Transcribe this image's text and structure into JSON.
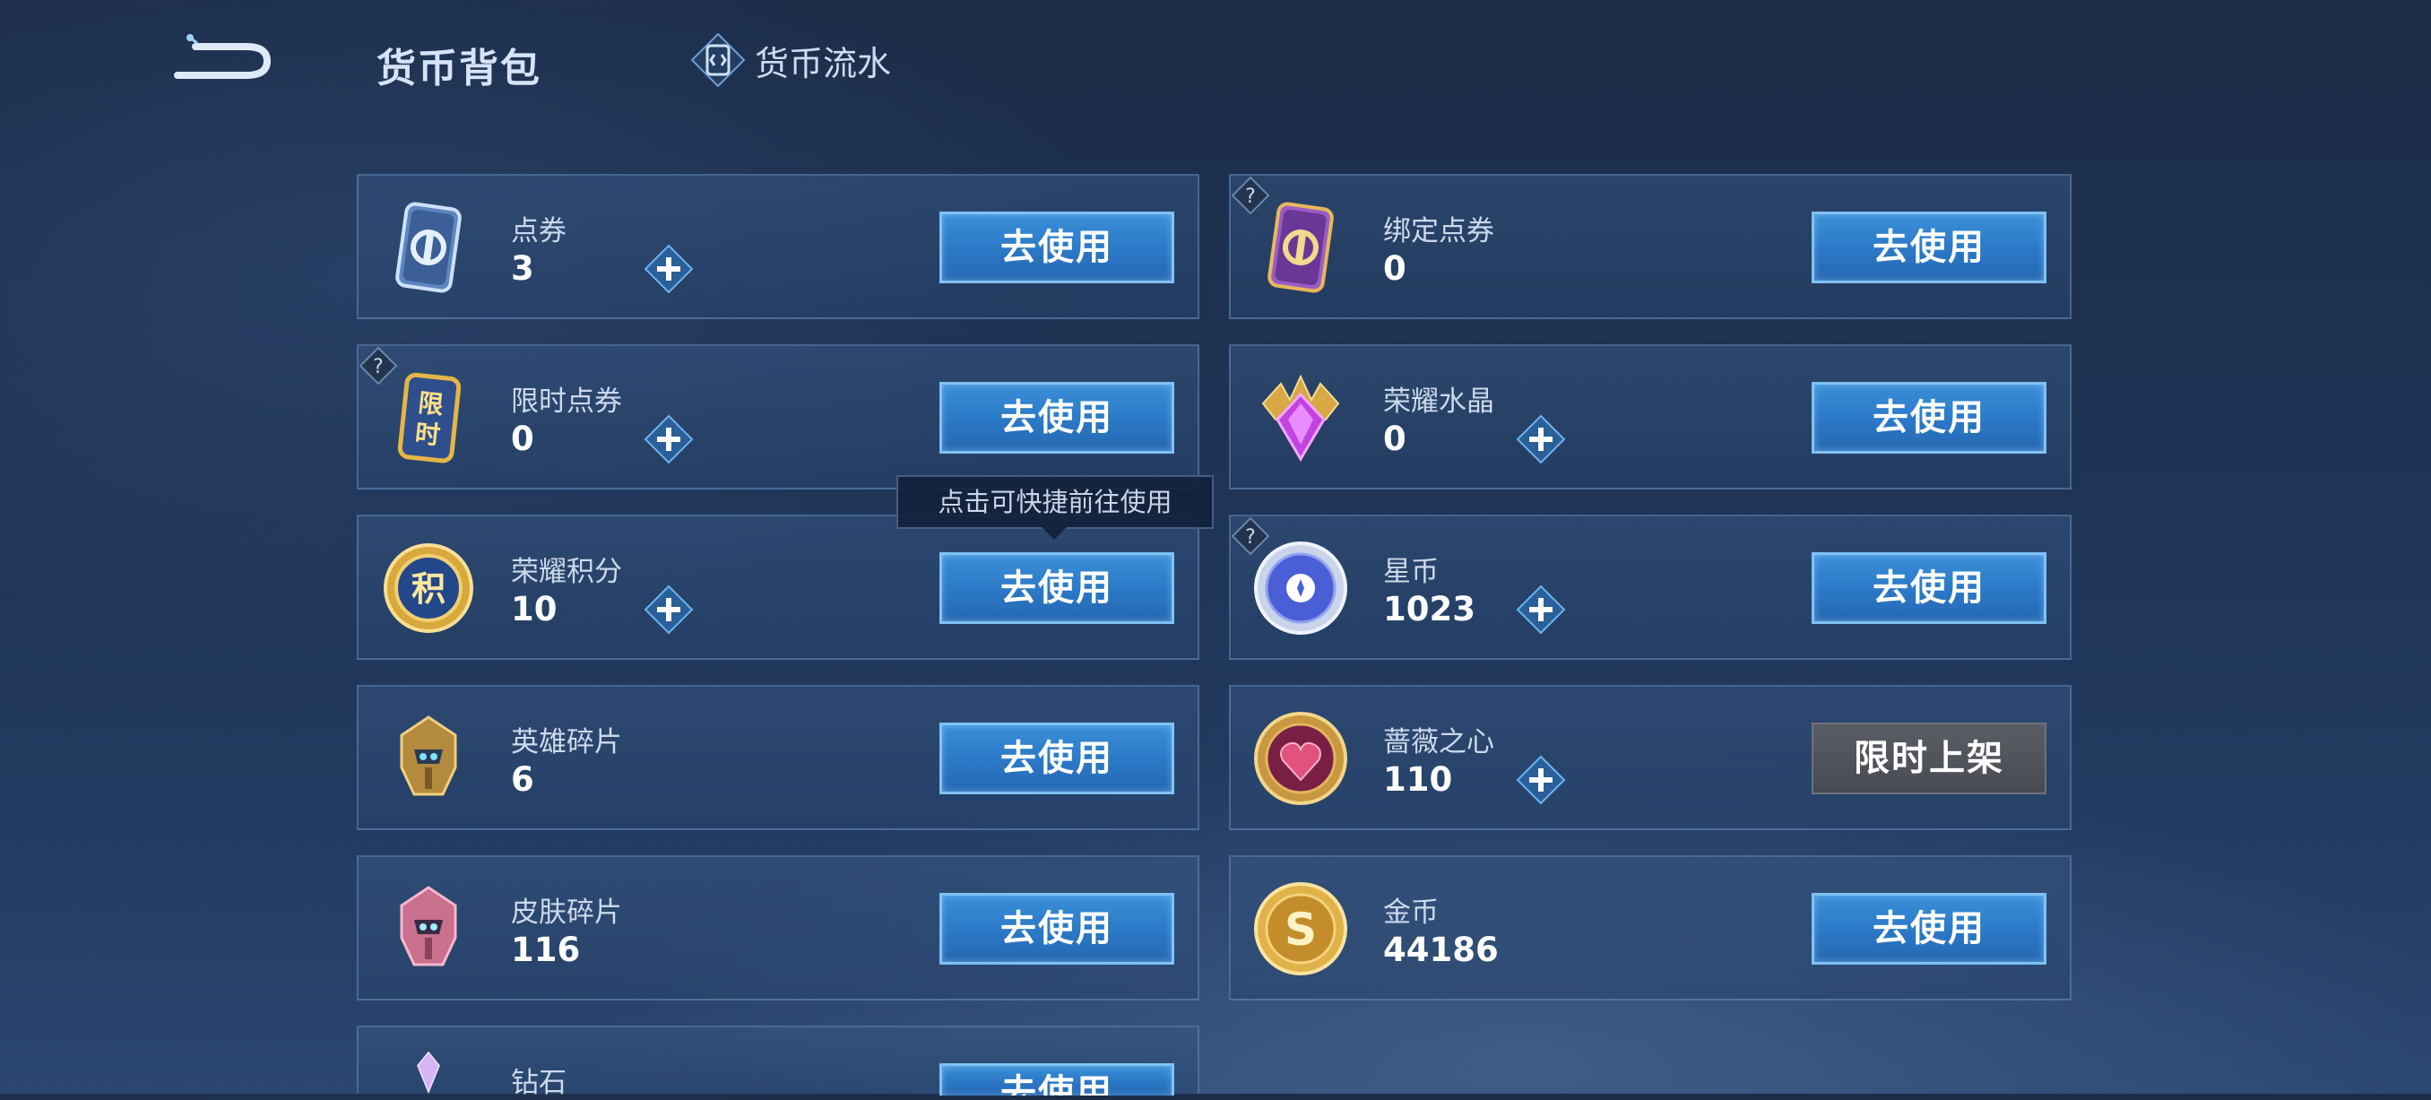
{
  "header": {
    "title": "货币背包",
    "flow_link": "货币流水"
  },
  "tooltip": "点击可快捷前往使用",
  "cards": [
    {
      "name": "点券",
      "value": "3",
      "button": "去使用",
      "icon": "coupon-card-icon"
    },
    {
      "name": "绑定点券",
      "value": "0",
      "button": "去使用",
      "icon": "bound-coupon-card-icon"
    },
    {
      "name": "限时点券",
      "value": "0",
      "button": "去使用",
      "icon": "limited-coupon-icon",
      "icon_text": "限时"
    },
    {
      "name": "荣耀水晶",
      "value": "0",
      "button": "去使用",
      "icon": "glory-crystal-icon"
    },
    {
      "name": "荣耀积分",
      "value": "10",
      "button": "去使用",
      "icon": "glory-points-icon",
      "icon_text": "积"
    },
    {
      "name": "星币",
      "value": "1023",
      "button": "去使用",
      "icon": "star-coin-icon"
    },
    {
      "name": "英雄碎片",
      "value": "6",
      "button": "去使用",
      "icon": "hero-fragment-icon"
    },
    {
      "name": "蔷薇之心",
      "value": "110",
      "button": "限时上架",
      "icon": "rose-heart-icon"
    },
    {
      "name": "皮肤碎片",
      "value": "116",
      "button": "去使用",
      "icon": "skin-fragment-icon"
    },
    {
      "name": "金币",
      "value": "44186",
      "button": "去使用",
      "icon": "gold-coin-icon"
    },
    {
      "name": "钻石",
      "value": "",
      "button": "去使用",
      "icon": "diamond-icon"
    }
  ],
  "colors": {
    "button_blue": "#2b78c6",
    "button_border": "#7fc2f5",
    "card_border": "#6e96c8",
    "gold": "#e0b24a",
    "gray_button": "#4e5258"
  }
}
